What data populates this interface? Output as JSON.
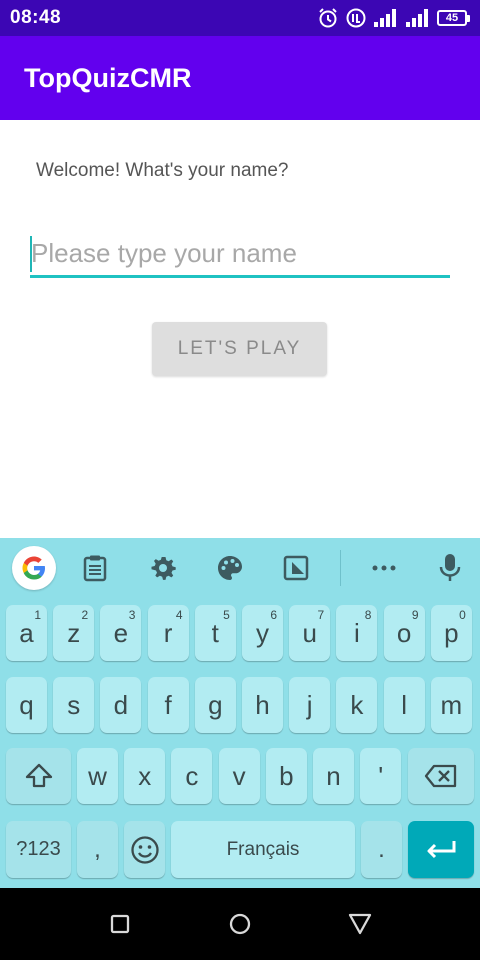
{
  "status_bar": {
    "time": "08:48",
    "battery_level": "45",
    "icons": [
      "alarm-icon",
      "data-saver-icon",
      "signal-1-icon",
      "signal-2-icon",
      "battery-icon"
    ]
  },
  "app_bar": {
    "title": "TopQuizCMR",
    "color": "#6200ee"
  },
  "main": {
    "welcome_text": "Welcome! What's your name?",
    "name_input": {
      "value": "",
      "placeholder": "Please type your name"
    },
    "play_button_label": "LET'S PLAY"
  },
  "keyboard": {
    "toolbar_icons": [
      "google-icon",
      "clipboard-icon",
      "settings-icon",
      "palette-icon",
      "one-handed-icon",
      "more-icon",
      "microphone-icon"
    ],
    "row1": [
      {
        "key": "a",
        "hint": "1"
      },
      {
        "key": "z",
        "hint": "2"
      },
      {
        "key": "e",
        "hint": "3"
      },
      {
        "key": "r",
        "hint": "4"
      },
      {
        "key": "t",
        "hint": "5"
      },
      {
        "key": "y",
        "hint": "6"
      },
      {
        "key": "u",
        "hint": "7"
      },
      {
        "key": "i",
        "hint": "8"
      },
      {
        "key": "o",
        "hint": "9"
      },
      {
        "key": "p",
        "hint": "0"
      }
    ],
    "row2": [
      "q",
      "s",
      "d",
      "f",
      "g",
      "h",
      "j",
      "k",
      "l",
      "m"
    ],
    "row3": [
      "w",
      "x",
      "c",
      "v",
      "b",
      "n",
      "'"
    ],
    "symbols_label": "?123",
    "comma_label": ",",
    "space_label": "Français",
    "period_label": ".",
    "accent_color": "#00a9b8"
  },
  "nav_bar": {
    "buttons": [
      "recents-icon",
      "home-icon",
      "back-icon"
    ]
  }
}
